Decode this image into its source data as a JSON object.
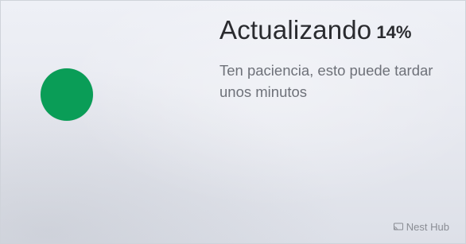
{
  "status": {
    "title": "Actualizando",
    "progress_label": "14%",
    "progress": 0.14,
    "message": "Ten paciencia, esto puede tardar unos minutos",
    "indicator_color": "#0a9d57"
  },
  "branding": {
    "label": "Nest Hub",
    "icon": "cast-icon"
  }
}
